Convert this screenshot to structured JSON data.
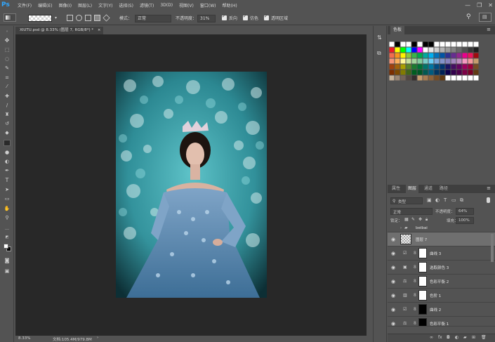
{
  "app": {
    "logo": "Ps"
  },
  "menu": [
    "文件(F)",
    "编辑(E)",
    "图像(I)",
    "图层(L)",
    "文字(Y)",
    "选择(S)",
    "滤镜(T)",
    "3D(D)",
    "视图(V)",
    "窗口(W)",
    "帮助(H)"
  ],
  "window_controls": {
    "minimize": "—",
    "maximize": "❐",
    "close": "✕"
  },
  "options": {
    "mode_label": "模式：",
    "mode_value": "正常",
    "opacity_label": "不透明度：",
    "opacity_value": "31%",
    "reverse_label": "反向",
    "dither_label": "仿色",
    "transparency_label": "透明区域"
  },
  "document": {
    "tab_title": "XIUTU.psd @ 8.33% (图层 7, RGB/8*) *",
    "tab_close": "×",
    "zoom": "8.33%",
    "doc_size": "文档:105.4M/979.8M",
    "status_arrow": "›"
  },
  "swatches": {
    "tab_label": "色板",
    "colors": [
      "#ffffff",
      "#000000",
      "#ffffff",
      "#ffffff",
      "#000000",
      "#ffffff",
      "#000000",
      "#000000",
      "#ffffff",
      "#ffffff",
      "#ffffff",
      "#ffffff",
      "#ffffff",
      "#ffffff",
      "#ffffff",
      "#ffffff",
      "#ed1c24",
      "#ffff00",
      "#00ff00",
      "#00ffff",
      "#0000ff",
      "#ff00ff",
      "#ffffff",
      "#e6e6e6",
      "#cdcdcd",
      "#b4b4b4",
      "#9b9b9b",
      "#828282",
      "#696969",
      "#505050",
      "#373737",
      "#1e1e1e",
      "#f26c4f",
      "#f7941d",
      "#fff200",
      "#8dc63f",
      "#39b54a",
      "#00a651",
      "#00a99d",
      "#00aeef",
      "#0072bc",
      "#0054a6",
      "#2e3192",
      "#662d91",
      "#92278f",
      "#ec008c",
      "#ed145b",
      "#9e0b0f",
      "#f69679",
      "#fbaf5d",
      "#fff79a",
      "#c4df9b",
      "#a3d39c",
      "#82ca9c",
      "#7accc8",
      "#6dcff6",
      "#7da7d8",
      "#8393ca",
      "#8781bd",
      "#a186be",
      "#bd8cbf",
      "#f49ac1",
      "#f5989d",
      "#c69c6d",
      "#a0410d",
      "#a36209",
      "#aba000",
      "#598527",
      "#1a7b30",
      "#007236",
      "#00746b",
      "#0076a3",
      "#004b80",
      "#003471",
      "#1b1464",
      "#440e62",
      "#630460",
      "#9e005d",
      "#9e0039",
      "#754c24",
      "#7b2e00",
      "#7d4900",
      "#827b00",
      "#406618",
      "#005e20",
      "#005826",
      "#005952",
      "#005b7f",
      "#003663",
      "#002157",
      "#0d004c",
      "#32004b",
      "#4b0049",
      "#7b0046",
      "#7a0026",
      "#603913",
      "#c7b299",
      "#998675",
      "#736357",
      "#534741",
      "#362f2d",
      "#c69c6d",
      "#a67c52",
      "#8c6239",
      "#754c24",
      "#603913",
      "#ffffff",
      "#ffffff",
      "#ffffff",
      "#ffffff",
      "#ffffff",
      "#ffffff"
    ]
  },
  "layers": {
    "tabs": [
      "属性",
      "图层",
      "通道",
      "路径"
    ],
    "filter_kind": "类型",
    "blend_mode": "正常",
    "opacity_label": "不透明度：",
    "opacity_value": "64%",
    "lock_label": "锁定：",
    "fill_label": "填充：",
    "fill_value": "100%",
    "items": [
      {
        "name": "beibai",
        "type": "group"
      },
      {
        "name": "图层 7",
        "type": "layer"
      },
      {
        "name": "曲线 3",
        "type": "adjust"
      },
      {
        "name": "选取颜色 3",
        "type": "adjust"
      },
      {
        "name": "色彩平衡 2",
        "type": "adjust"
      },
      {
        "name": "色阶 1",
        "type": "adjust"
      },
      {
        "name": "曲线 2",
        "type": "adjust"
      },
      {
        "name": "色彩平衡 1",
        "type": "adjust"
      }
    ]
  }
}
